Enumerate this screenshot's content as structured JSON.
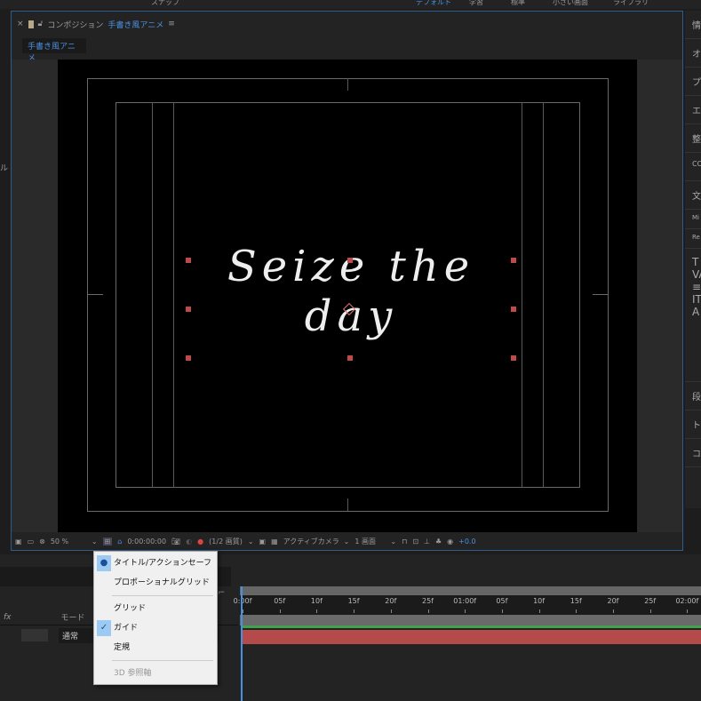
{
  "topbar": {
    "left_label": "スナップ",
    "workspaces": [
      "デフォルト",
      "学習",
      "標準",
      "小さい画面",
      "ライブラリ"
    ]
  },
  "panel": {
    "tab_prefix": "コンポジション",
    "comp_name": "手書き風アニメ",
    "menu_glyph": "≡",
    "close": "×",
    "subtab": "手書き風アニメ"
  },
  "canvas": {
    "text": "Seize the day"
  },
  "viewer_toolbar": {
    "zoom": "50 %",
    "timecode": "0:00:00:00",
    "resolution": "(1/2 画質)",
    "camera": "アクティブカメラ",
    "views": "1 画面",
    "exposure": "+0.0"
  },
  "right_panel": {
    "items": [
      "情",
      "オ",
      "プ",
      "エ",
      "整",
      "CC",
      "文",
      "Mi",
      "Re",
      "段",
      "ト",
      "コ"
    ]
  },
  "left_panel": {
    "fragment": "ル"
  },
  "dropdown_menu": {
    "items": [
      {
        "label": "タイトル/アクションセーフ",
        "mark": "●",
        "enabled": true
      },
      {
        "label": "プロポーショナルグリッド",
        "mark": "",
        "enabled": true
      },
      {
        "label": "グリッド",
        "mark": "",
        "enabled": true
      },
      {
        "label": "ガイド",
        "mark": "✓",
        "enabled": true
      },
      {
        "label": "定規",
        "mark": "",
        "enabled": true
      },
      {
        "label": "3D 参照軸",
        "mark": "",
        "enabled": false
      }
    ]
  },
  "timeline": {
    "mode_header": "モード",
    "layer_mode": "通常",
    "switch_icons": "fx",
    "ruler": [
      "0:00f",
      "05f",
      "10f",
      "15f",
      "20f",
      "25f",
      "01:00f",
      "05f",
      "10f",
      "15f",
      "20f",
      "25f",
      "02:00f"
    ]
  },
  "colors": {
    "accent": "#4a90e2",
    "layer_bar": "#b54a4a",
    "work_area": "#3fa34d"
  }
}
